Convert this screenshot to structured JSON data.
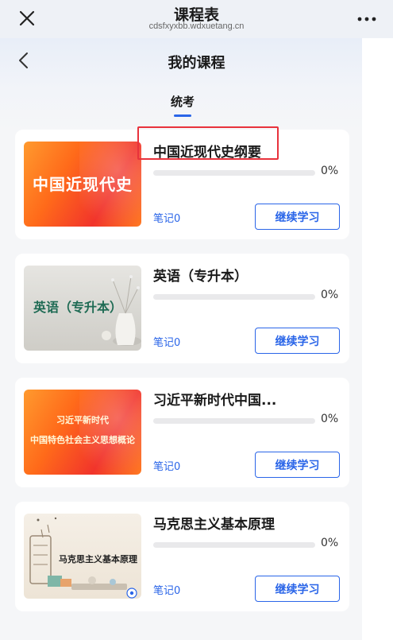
{
  "topbar": {
    "title": "课程表",
    "url": "cdsfxyxbb.wdxuetang.cn"
  },
  "header": {
    "title": "我的课程",
    "tab": "统考"
  },
  "courses": [
    {
      "title": "中国近现代史纲要",
      "thumb_text": "中国近现代史",
      "progress": 0,
      "progress_text": "0%",
      "notes": "笔记0",
      "button": "继续学习"
    },
    {
      "title": "英语（专升本）",
      "thumb_text": "英语（专升本）",
      "progress": 0,
      "progress_text": "0%",
      "notes": "笔记0",
      "button": "继续学习"
    },
    {
      "title": "习近平新时代中国...",
      "thumb_line1": "习近平新时代",
      "thumb_line2": "中国特色社会主义思想概论",
      "progress": 0,
      "progress_text": "0%",
      "notes": "笔记0",
      "button": "继续学习"
    },
    {
      "title": "马克思主义基本原理",
      "thumb_text": "马克思主义基本原理",
      "progress": 0,
      "progress_text": "0%",
      "notes": "笔记0",
      "button": "继续学习"
    }
  ],
  "colors": {
    "accent": "#2a65e8",
    "highlight": "#e8323c"
  },
  "icons": {
    "close": "close-icon",
    "more": "more-icon",
    "back": "back-icon"
  }
}
